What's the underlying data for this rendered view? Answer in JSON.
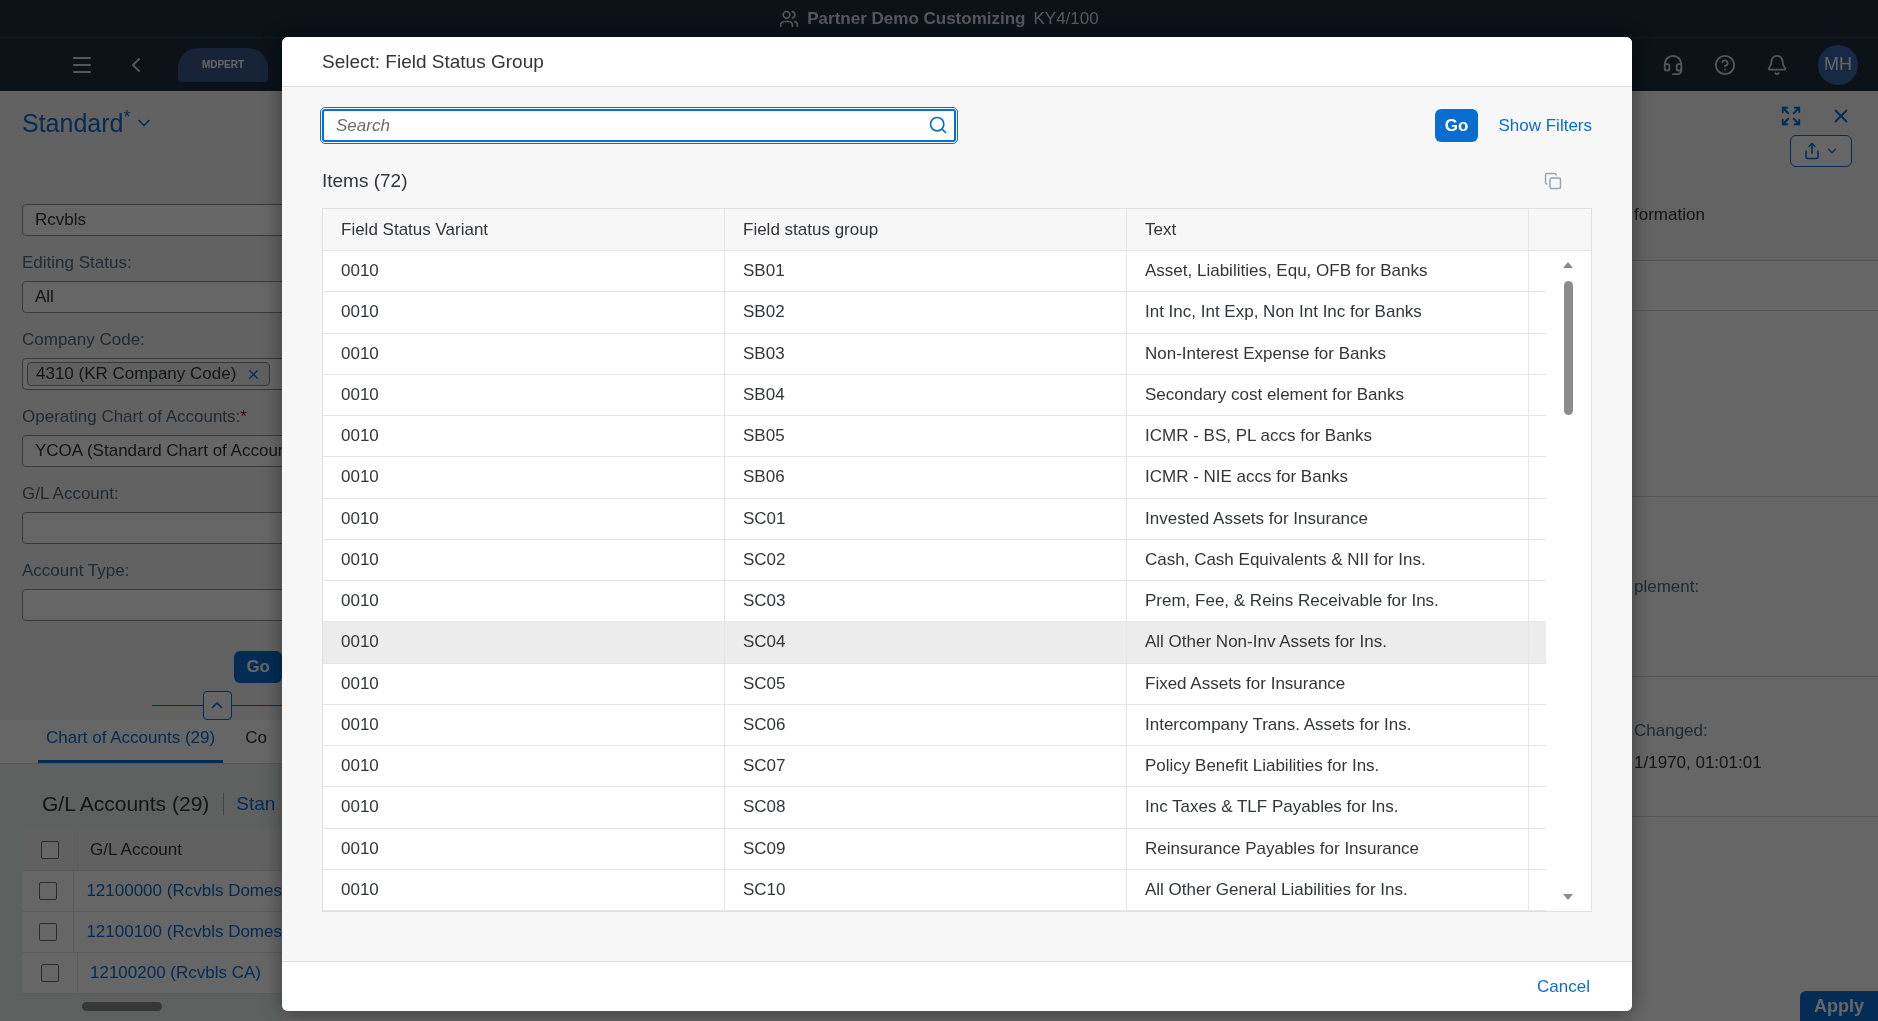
{
  "title_bar": {
    "title": "Partner Demo Customizing",
    "system": "KY4/100"
  },
  "shell": {
    "logo": "MDPERT",
    "avatar": "MH"
  },
  "filter_panel": {
    "variant": "Standard",
    "variant_mark": "*",
    "search_value": "Rcvbls",
    "fields": [
      {
        "kind": "select",
        "label": "Editing Status:",
        "value": "All"
      },
      {
        "kind": "token",
        "label": "Company Code:",
        "token": "4310 (KR Company Code)"
      },
      {
        "kind": "input",
        "label": "Operating Chart of Accounts:",
        "required_mark": "*",
        "value": "YCOA (Standard Chart of Accour"
      },
      {
        "kind": "input",
        "label": "G/L Account:"
      },
      {
        "kind": "input",
        "label": "Account Type:"
      }
    ],
    "go": "Go"
  },
  "tabs": [
    {
      "label": "Chart of Accounts (29)",
      "selected": true
    },
    {
      "label": "Co",
      "selected": false
    }
  ],
  "accounts": {
    "title": "G/L Accounts (29)",
    "variant": "Stan",
    "column": "G/L Account",
    "all_checked": false,
    "rows": [
      {
        "label": "12100000 (Rcvbls Domes",
        "checked": false
      },
      {
        "label": "12100100 (Rcvbls Domes",
        "checked": false
      },
      {
        "label": "12100200 (Rcvbls CA)",
        "checked": false
      }
    ]
  },
  "detail": {
    "tab": "formation",
    "label_1": "plement:",
    "label_2": "Changed:",
    "value_2": "1/1970, 01:01:01",
    "apply": "Apply"
  },
  "dialog": {
    "title": "Select: Field Status Group",
    "search_placeholder": "Search",
    "go": "Go",
    "show_filters": "Show Filters",
    "items_title": "Items (72)",
    "columns": [
      "Field Status Variant",
      "Field status group",
      "Text"
    ],
    "rows": [
      {
        "cells": [
          "0010",
          "SB01",
          "Asset, Liabilities, Equ, OFB for Banks"
        ],
        "selected": false
      },
      {
        "cells": [
          "0010",
          "SB02",
          "Int Inc, Int Exp, Non Int Inc for Banks"
        ],
        "selected": false
      },
      {
        "cells": [
          "0010",
          "SB03",
          "Non-Interest Expense for Banks"
        ],
        "selected": false
      },
      {
        "cells": [
          "0010",
          "SB04",
          "Secondary cost element for Banks"
        ],
        "selected": false
      },
      {
        "cells": [
          "0010",
          "SB05",
          "ICMR - BS, PL accs for Banks"
        ],
        "selected": false
      },
      {
        "cells": [
          "0010",
          "SB06",
          "ICMR - NIE accs for Banks"
        ],
        "selected": false
      },
      {
        "cells": [
          "0010",
          "SC01",
          "Invested Assets for Insurance"
        ],
        "selected": false
      },
      {
        "cells": [
          "0010",
          "SC02",
          "Cash, Cash Equivalents & NII for Ins."
        ],
        "selected": false
      },
      {
        "cells": [
          "0010",
          "SC03",
          "Prem, Fee, & Reins Receivable for Ins."
        ],
        "selected": false
      },
      {
        "cells": [
          "0010",
          "SC04",
          "All Other Non-Inv Assets for Ins."
        ],
        "selected": true
      },
      {
        "cells": [
          "0010",
          "SC05",
          "Fixed Assets for Insurance"
        ],
        "selected": false
      },
      {
        "cells": [
          "0010",
          "SC06",
          "Intercompany Trans. Assets for Ins."
        ],
        "selected": false
      },
      {
        "cells": [
          "0010",
          "SC07",
          "Policy Benefit Liabilities for Ins."
        ],
        "selected": false
      },
      {
        "cells": [
          "0010",
          "SC08",
          "Inc Taxes & TLF Payables for Ins."
        ],
        "selected": false
      },
      {
        "cells": [
          "0010",
          "SC09",
          "Reinsurance Payables for Insurance"
        ],
        "selected": false
      },
      {
        "cells": [
          "0010",
          "SC10",
          "All Other General Liabilities for Ins."
        ],
        "selected": false
      }
    ],
    "cancel": "Cancel"
  }
}
